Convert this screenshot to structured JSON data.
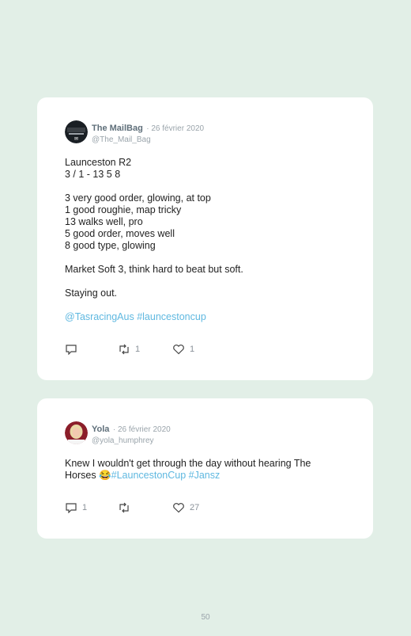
{
  "tweets": [
    {
      "name": "The MailBag",
      "date": "· 26 février 2020",
      "handle": "@The_Mail_Bag",
      "lines": [
        "Launceston R2",
        "3 / 1 - 13 5 8",
        "",
        "3 very good order, glowing, at top",
        "1 good roughie, map tricky",
        "13 walks well, pro",
        "5 good order, moves well",
        "8 good type, glowing",
        "",
        "Market Soft 3, think hard to beat but soft.",
        "",
        "Staying out.",
        ""
      ],
      "mentions": "@TasracingAus #launcestoncup",
      "reply_count": "",
      "retweet_count": "1",
      "like_count": "1"
    },
    {
      "name": "Yola",
      "date": "· 26 février 2020",
      "handle": "@yola_humphrey",
      "text_line1": "Knew I wouldn't get through the day without hearing The",
      "text_line2_plain": "Horses 😂",
      "text_line2_tags": "#LauncestonCup #Jansz",
      "reply_count": "1",
      "retweet_count": "",
      "like_count": "27"
    }
  ],
  "page_number": "50",
  "icons": [
    "reply-icon",
    "retweet-icon",
    "like-icon"
  ],
  "colors": {
    "background": "#e2efe7",
    "hashtag": "#5fb8e0"
  }
}
